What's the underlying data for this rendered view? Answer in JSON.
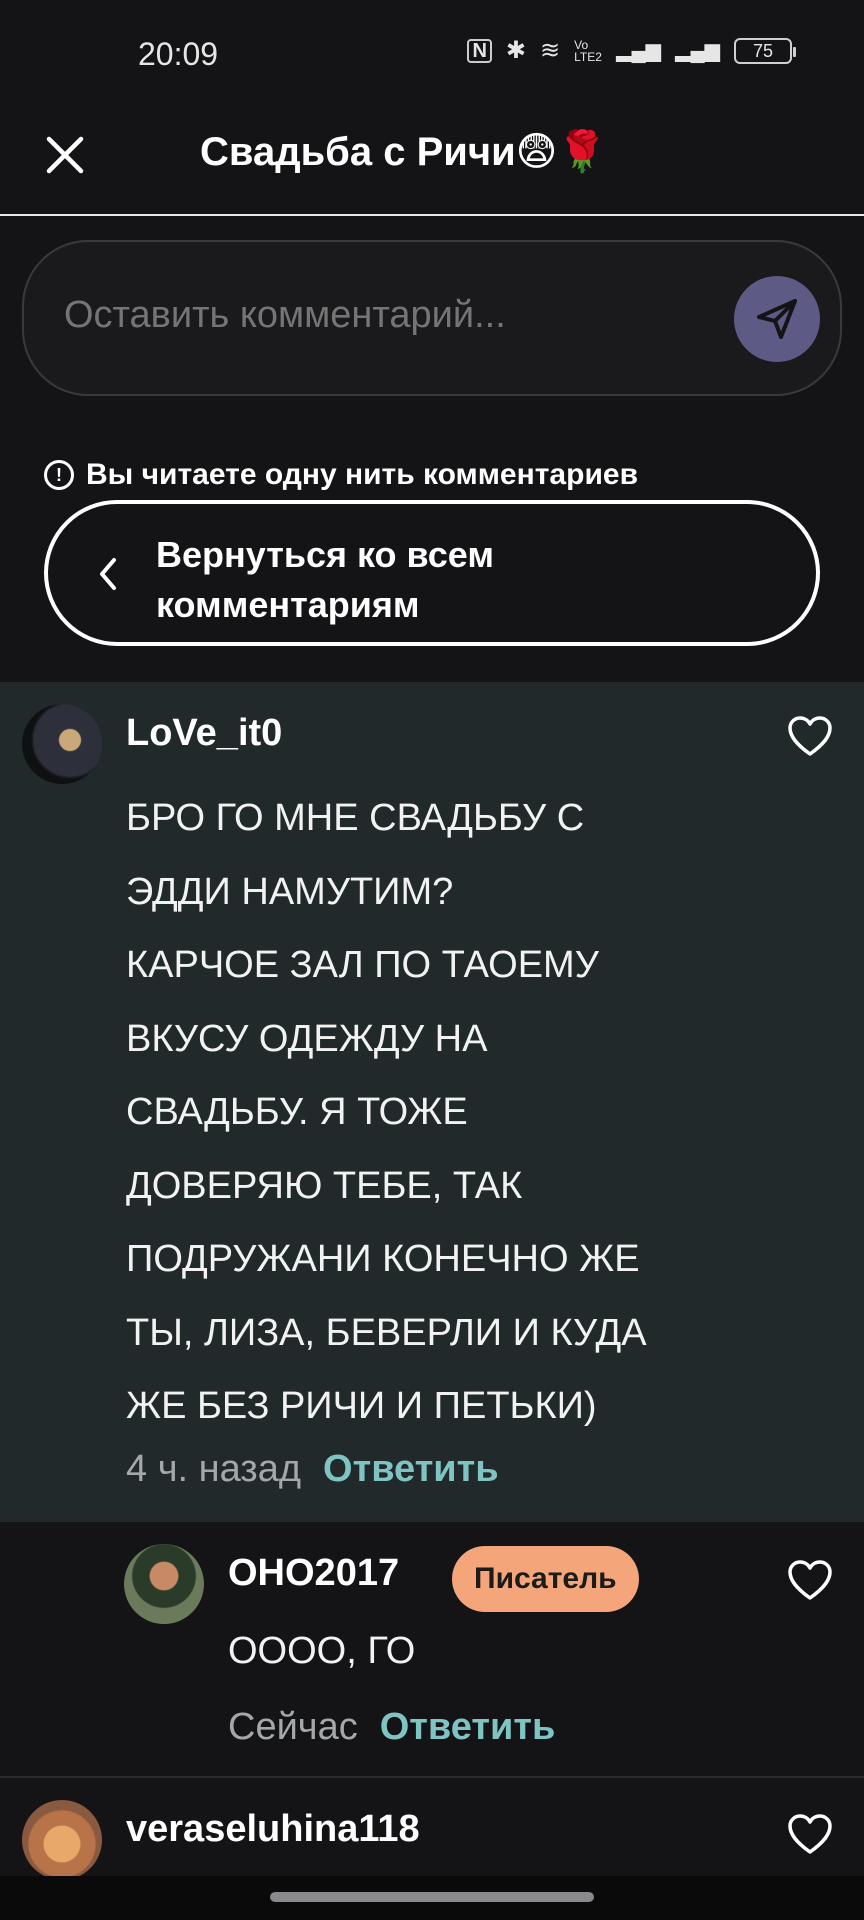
{
  "status_bar": {
    "time": "20:09",
    "nfc": "N",
    "bluetooth": "✱",
    "wifi": "≋",
    "volte": "Vo LTE2",
    "signal1": "▂▄▆",
    "signal2": "▂▄▆",
    "battery": "75"
  },
  "header": {
    "title": "Свадьба с Ричи😨🌹"
  },
  "comment_input": {
    "placeholder": "Оставить комментарий..."
  },
  "thread": {
    "notice": "Вы читаете одну нить комментариев",
    "back_label": "Вернуться ко всем комментариям"
  },
  "main_comment": {
    "author": "LoVe_it0",
    "text": "БРО ГО МНЕ СВАДЬБУ С ЭДДИ НАМУТИМ? КАРЧОЕ ЗАЛ ПО ТАОЕМУ ВКУСУ ОДЕЖДУ НА СВАДЬБУ. Я ТОЖЕ ДОВЕРЯЮ ТЕБЕ, ТАК ПОДРУЖАНИ КОНЕЧНО ЖЕ ТЫ, ЛИЗА, БЕВЕРЛИ И КУДА ЖЕ БЕЗ РИЧИ И ПЕТЬКИ)",
    "lines": [
      "БРО ГО МНЕ СВАДЬБУ С",
      "ЭДДИ НАМУТИМ?",
      "КАРЧОЕ ЗАЛ ПО ТАОЕМУ",
      "ВКУСУ ОДЕЖДУ НА",
      "СВАДЬБУ. Я ТОЖЕ",
      "ДОВЕРЯЮ ТЕБЕ, ТАК",
      "ПОДРУЖАНИ КОНЕЧНО ЖЕ",
      "ТЫ, ЛИЗА, БЕВЕРЛИ И КУДА",
      "ЖЕ БЕЗ РИЧИ И ПЕТЬКИ)"
    ],
    "time": "4 ч. назад",
    "reply_label": "Ответить"
  },
  "reply_comment": {
    "author": "OHO2017",
    "badge": "Писатель",
    "text": "OOOO, ГО",
    "time": "Сейчас",
    "reply_label": "Ответить"
  },
  "next_comment": {
    "author": "veraseluhina118"
  },
  "colors": {
    "background": "#141416",
    "highlight_bg": "#21292b",
    "reply_link": "#7fc3c2",
    "badge": "#f5a57a",
    "send_button": "#5e5a86"
  }
}
